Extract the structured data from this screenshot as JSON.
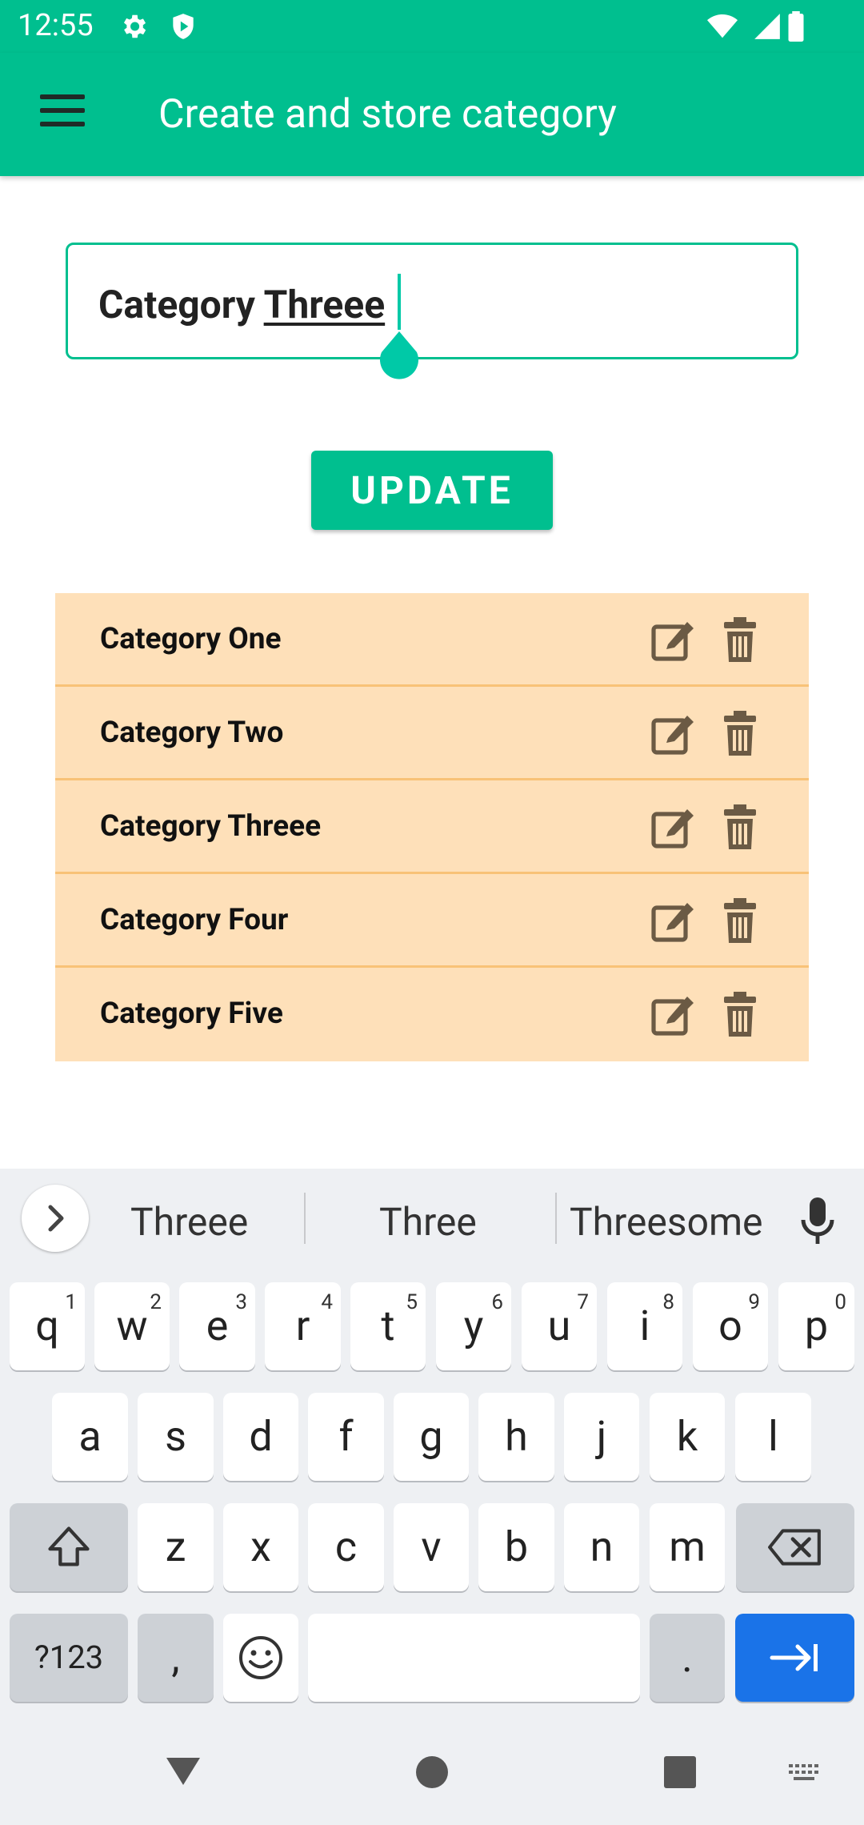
{
  "status_bar": {
    "time": "12:55"
  },
  "app_bar": {
    "title": "Create and store category"
  },
  "input": {
    "prefix": "Category ",
    "underlined": "Threee"
  },
  "update_button": {
    "label": "UPDATE"
  },
  "categories": [
    {
      "label": "Category One"
    },
    {
      "label": "Category Two"
    },
    {
      "label": "Category Threee"
    },
    {
      "label": "Category Four"
    },
    {
      "label": "Category Five"
    }
  ],
  "keyboard": {
    "suggestions": [
      "Threee",
      "Three",
      "Threesome"
    ],
    "row1": [
      {
        "k": "q",
        "h": "1"
      },
      {
        "k": "w",
        "h": "2"
      },
      {
        "k": "e",
        "h": "3"
      },
      {
        "k": "r",
        "h": "4"
      },
      {
        "k": "t",
        "h": "5"
      },
      {
        "k": "y",
        "h": "6"
      },
      {
        "k": "u",
        "h": "7"
      },
      {
        "k": "i",
        "h": "8"
      },
      {
        "k": "o",
        "h": "9"
      },
      {
        "k": "p",
        "h": "0"
      }
    ],
    "row2": [
      "a",
      "s",
      "d",
      "f",
      "g",
      "h",
      "j",
      "k",
      "l"
    ],
    "row3": [
      "z",
      "x",
      "c",
      "v",
      "b",
      "n",
      "m"
    ],
    "symbols_label": "?123",
    "comma_label": ",",
    "period_label": "."
  },
  "colors": {
    "primary": "#00bf8f",
    "row_bg": "#fee0b9",
    "row_divider": "#f8c277",
    "icon": "#6b5a44",
    "enter": "#1a73e8"
  }
}
